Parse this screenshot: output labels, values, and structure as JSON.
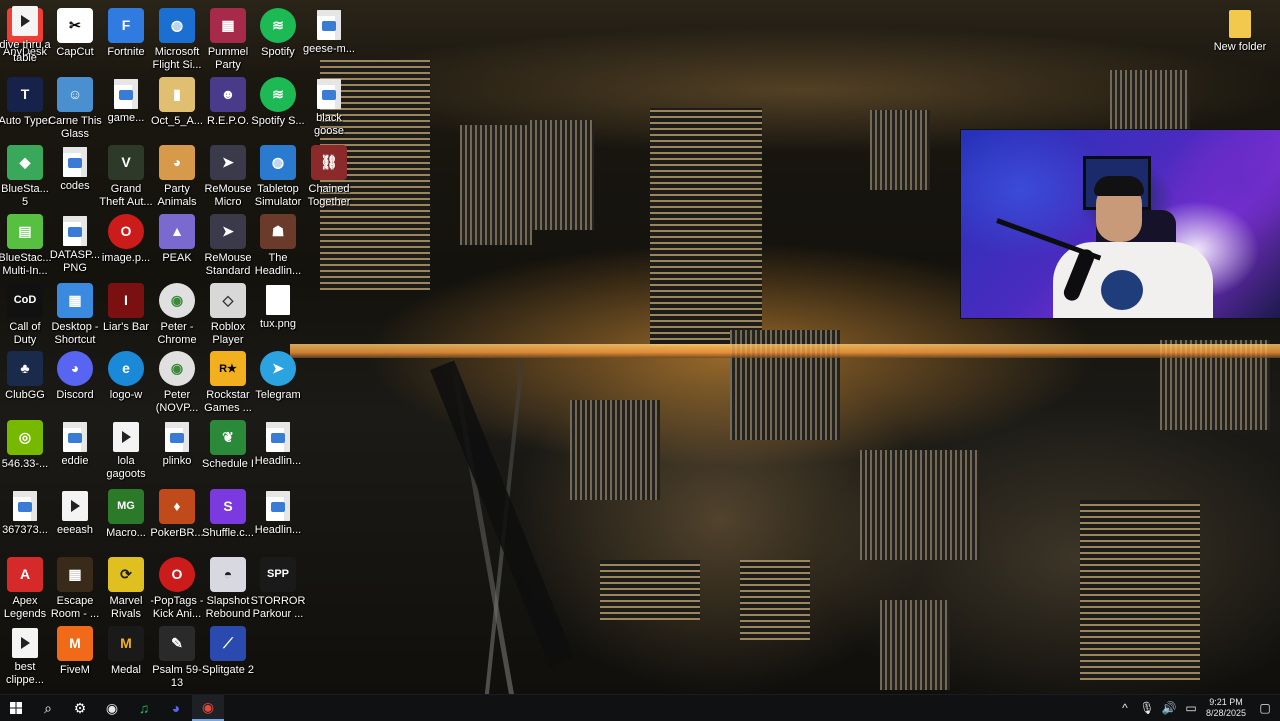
{
  "desktop": {
    "icons": [
      {
        "label": "AnyDesk",
        "type": "app",
        "bg": "#ef3e36",
        "text": "❖"
      },
      {
        "label": "CapCut",
        "type": "app",
        "bg": "#ffffff",
        "text": "✂",
        "fg": "#000000"
      },
      {
        "label": "Fortnite",
        "type": "app",
        "bg": "#2f7be0",
        "text": "F"
      },
      {
        "label": "Microsoft Flight Si...",
        "type": "app",
        "bg": "#1b6fd1",
        "text": "◍"
      },
      {
        "label": "Pummel Party",
        "type": "app",
        "bg": "#a82a4a",
        "text": "▦"
      },
      {
        "label": "Spotify",
        "type": "app",
        "bg": "#1db954",
        "text": "≋",
        "round": true
      },
      {
        "label": "geese-m...",
        "type": "doc"
      },
      {
        "label": "Auto Typer",
        "type": "app",
        "bg": "#16224a",
        "text": "T"
      },
      {
        "label": "Carne This Glass",
        "type": "app",
        "bg": "#4a8fd0",
        "text": "☺"
      },
      {
        "label": "game...",
        "type": "doc"
      },
      {
        "label": "Oct_5_A...",
        "type": "app",
        "bg": "#e0c070",
        "text": "▮"
      },
      {
        "label": "R.E.P.O.",
        "type": "app",
        "bg": "#4a3a8a",
        "text": "☻"
      },
      {
        "label": "Spotify S...",
        "type": "app",
        "bg": "#1db954",
        "text": "≋",
        "round": true
      },
      {
        "label": "black goose",
        "type": "doc"
      },
      {
        "label": "BlueSta... 5",
        "type": "app",
        "bg": "#3aa85a",
        "text": "◆"
      },
      {
        "label": "codes",
        "type": "doc"
      },
      {
        "label": "Grand Theft Aut...",
        "type": "app",
        "bg": "#2d3a2a",
        "text": "V"
      },
      {
        "label": "Party Animals",
        "type": "app",
        "bg": "#d79a4a",
        "text": "◕"
      },
      {
        "label": "ReMouse Micro",
        "type": "app",
        "bg": "#3a3a4a",
        "text": "➤"
      },
      {
        "label": "Tabletop Simulator",
        "type": "app",
        "bg": "#2a7ad0",
        "text": "◍"
      },
      {
        "label": "Chained Together",
        "type": "app",
        "bg": "#8a2a2a",
        "text": "⛓"
      },
      {
        "label": "BlueStac... Multi-In...",
        "type": "app",
        "bg": "#58c040",
        "text": "▤"
      },
      {
        "label": "DATASP... PNG",
        "type": "doc"
      },
      {
        "label": "image.p...",
        "type": "app",
        "bg": "#cc1b1b",
        "text": "O",
        "round": true
      },
      {
        "label": "PEAK",
        "type": "app",
        "bg": "#7a6ad0",
        "text": "▲"
      },
      {
        "label": "ReMouse Standard",
        "type": "app",
        "bg": "#3a3a4a",
        "text": "➤"
      },
      {
        "label": "The Headlin...",
        "type": "app",
        "bg": "#6a3a2a",
        "text": "☗"
      },
      {
        "label": "Call of Duty",
        "type": "app",
        "bg": "#111111",
        "text": "CoD"
      },
      {
        "label": "Desktop - Shortcut",
        "type": "app",
        "bg": "#3a8ae0",
        "text": "▦"
      },
      {
        "label": "Liar's Bar",
        "type": "app",
        "bg": "#7a1010",
        "text": "I"
      },
      {
        "label": "Peter - Chrome",
        "type": "app",
        "bg": "#e0e0e0",
        "text": "◉",
        "round": true,
        "fg": "#3a8a3a"
      },
      {
        "label": "Roblox Player",
        "type": "app",
        "bg": "#d8d8d8",
        "text": "◇",
        "fg": "#333333"
      },
      {
        "label": "tux.png",
        "type": "blank"
      },
      {
        "label": "ClubGG",
        "type": "app",
        "bg": "#1a2a4a",
        "text": "♣"
      },
      {
        "label": "Discord",
        "type": "app",
        "bg": "#5865f2",
        "text": "◕",
        "round": true
      },
      {
        "label": "logo-w",
        "type": "app",
        "bg": "#1a8ad8",
        "text": "e",
        "round": true
      },
      {
        "label": "Peter (NOVP...",
        "type": "app",
        "bg": "#e0e0e0",
        "text": "◉",
        "round": true,
        "fg": "#3a8a3a"
      },
      {
        "label": "Rockstar Games ...",
        "type": "app",
        "bg": "#f2b01e",
        "text": "R★",
        "fg": "#000000"
      },
      {
        "label": "Telegram",
        "type": "app",
        "bg": "#2aa3e0",
        "text": "➤",
        "round": true
      },
      {
        "label": "546.33-...",
        "type": "app",
        "bg": "#76b900",
        "text": "◎"
      },
      {
        "label": "eddie",
        "type": "doc"
      },
      {
        "label": "lola gagoots",
        "type": "vid"
      },
      {
        "label": "plinko",
        "type": "doc"
      },
      {
        "label": "Schedule I",
        "type": "app",
        "bg": "#2a8a3a",
        "text": "❦"
      },
      {
        "label": "Headlin...",
        "type": "doc"
      },
      {
        "label": "367373...",
        "type": "doc"
      },
      {
        "label": "eeeash",
        "type": "vid"
      },
      {
        "label": "Macro...",
        "type": "app",
        "bg": "#2a7a2a",
        "text": "MG"
      },
      {
        "label": "PokerBR...",
        "type": "app",
        "bg": "#c04a1a",
        "text": "♦"
      },
      {
        "label": "Shuffle.c...",
        "type": "app",
        "bg": "#7a3ae0",
        "text": "S"
      },
      {
        "label": "Headlin...",
        "type": "doc"
      },
      {
        "label": "Apex Legends",
        "type": "app",
        "bg": "#d62a2a",
        "text": "A"
      },
      {
        "label": "Escape Room - ...",
        "type": "app",
        "bg": "#3a2a1a",
        "text": "▦"
      },
      {
        "label": "Marvel Rivals",
        "type": "app",
        "bg": "#e0c020",
        "text": "⟳",
        "fg": "#1a1a1a"
      },
      {
        "label": "-PopTags - Kick Ani...",
        "type": "app",
        "bg": "#cc1b1b",
        "text": "O",
        "round": true
      },
      {
        "label": "Slapshot Rebound",
        "type": "app",
        "bg": "#d8d8e0",
        "text": "◓",
        "fg": "#222222"
      },
      {
        "label": "STORROR Parkour ...",
        "type": "app",
        "bg": "#1a1a1a",
        "text": "SPP"
      },
      {
        "label": "best clippe...",
        "type": "vid"
      },
      {
        "label": "FiveM",
        "type": "app",
        "bg": "#f06a1a",
        "text": "M"
      },
      {
        "label": "Medal",
        "type": "app",
        "bg": "#1a1a1a",
        "text": "M",
        "fg": "#f0b020"
      },
      {
        "label": "Psalm 59-13",
        "type": "app",
        "bg": "#2a2a2a",
        "text": "✎"
      },
      {
        "label": "Splitgate 2",
        "type": "app",
        "bg": "#2a4ab0",
        "text": "⟋"
      },
      {
        "label": "dive thru a table",
        "type": "vid"
      }
    ],
    "new_folder": {
      "label": "New folder"
    }
  },
  "taskbar": {
    "start_icon": "windows-logo",
    "items": [
      {
        "name": "search",
        "glyph": "⌕"
      },
      {
        "name": "settings",
        "glyph": "⚙"
      },
      {
        "name": "obs",
        "glyph": "◉"
      },
      {
        "name": "spotify",
        "glyph": "♫"
      },
      {
        "name": "discord",
        "glyph": "◕"
      },
      {
        "name": "chrome",
        "glyph": "◉",
        "active": true
      }
    ],
    "tray": {
      "chevron": "^",
      "mic": "🎙",
      "volume": "🔊",
      "network": "▭",
      "time": "9:21 PM",
      "date": "8/28/2025",
      "notifications": "▢"
    }
  }
}
